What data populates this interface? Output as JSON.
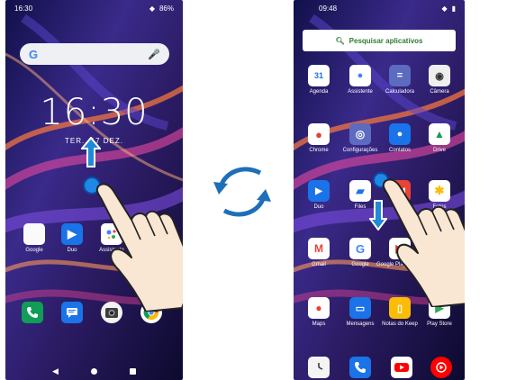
{
  "left_screen": {
    "status": {
      "time": "16:30",
      "battery": "86%"
    },
    "clock": "16:30",
    "date": "TER., 17 DEZ.",
    "apps": [
      {
        "label": "Google",
        "icon": "google-folder-icon"
      },
      {
        "label": "Duo",
        "icon": "duo-icon"
      },
      {
        "label": "Assistente",
        "icon": "assistant-icon"
      }
    ],
    "dock": [
      "phone-icon",
      "messages-icon",
      "camera-icon",
      "chrome-icon"
    ]
  },
  "right_screen": {
    "status": {
      "time": "09:48"
    },
    "search_placeholder": "Pesquisar aplicativos",
    "apps": [
      {
        "label": "Agenda",
        "icon": "calendar-icon"
      },
      {
        "label": "Assistente",
        "icon": "assistant-icon"
      },
      {
        "label": "Calculadora",
        "icon": "calculator-icon"
      },
      {
        "label": "Câmera",
        "icon": "camera-icon"
      },
      {
        "label": "Chrome",
        "icon": "chrome-icon"
      },
      {
        "label": "Configurações",
        "icon": "settings-icon"
      },
      {
        "label": "Contatos",
        "icon": "contacts-icon"
      },
      {
        "label": "Drive",
        "icon": "drive-icon"
      },
      {
        "label": "Duo",
        "icon": "duo-icon"
      },
      {
        "label": "Files",
        "icon": "files-icon"
      },
      {
        "label": "FM",
        "icon": "fm-radio-icon"
      },
      {
        "label": "Fotos",
        "icon": "photos-icon"
      },
      {
        "label": "Gmail",
        "icon": "gmail-icon"
      },
      {
        "label": "Google",
        "icon": "google-icon"
      },
      {
        "label": "Google Play Filmes",
        "icon": "play-movies-icon"
      },
      {
        "label": "G",
        "icon": "google-app-icon"
      },
      {
        "label": "Maps",
        "icon": "maps-icon"
      },
      {
        "label": "Mensagens",
        "icon": "messages-icon"
      },
      {
        "label": "Notas do Keep",
        "icon": "keep-icon"
      },
      {
        "label": "Play Store",
        "icon": "play-store-icon"
      }
    ],
    "dock": [
      "clock-icon",
      "phone-icon",
      "youtube-icon",
      "youtube-music-icon"
    ]
  },
  "colors": {
    "accent_blue": "#1565c0",
    "search_green": "#2e7d32"
  }
}
